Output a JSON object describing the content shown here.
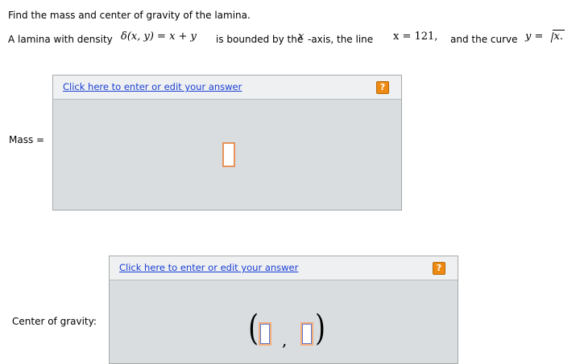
{
  "question": {
    "title": "Find the mass and center of gravity of the lamina.",
    "intro": "A lamina with density",
    "density_expr": "δ(x, y) = x + y",
    "bounded_text": "is bounded by the",
    "x_symbol": "x",
    "axis_text": "-axis, the line",
    "line_expr": "x = 121,",
    "curve_text": "and the curve",
    "curve_lhs": "y =",
    "curve_radicand": "x."
  },
  "mass": {
    "label": "Mass =",
    "edit_link": "Click here to enter or edit your answer",
    "help_glyph": "?"
  },
  "center": {
    "label": "Center of gravity:",
    "edit_link": "Click here to enter or edit your answer",
    "help_glyph": "?",
    "open_paren": "(",
    "separator": ",",
    "close_paren": ")"
  },
  "colors": {
    "box_bg": "#d9dde0",
    "header_bg": "#eef0f1",
    "link": "#1a3fd4",
    "help_icon": "#ee8a12",
    "slot_border": "#e7935a"
  }
}
